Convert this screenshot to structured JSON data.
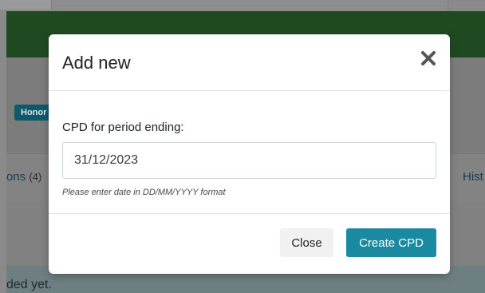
{
  "background": {
    "badge_label": "Honor",
    "tab_left_label": "ons",
    "tab_left_count": "(4)",
    "tab_right_label": "Hist",
    "empty_message": "ded yet."
  },
  "modal": {
    "title": "Add new",
    "field_label": "CPD for period ending:",
    "date_value": "31/12/2023",
    "help_text": "Please enter date in DD/MM/YYYY format",
    "close_button": "Close",
    "create_button": "Create CPD",
    "close_icon": "close-icon"
  },
  "colors": {
    "primary_button": "#1a8aa0",
    "header_green": "#1f4a21",
    "badge": "#0e5a6a"
  }
}
